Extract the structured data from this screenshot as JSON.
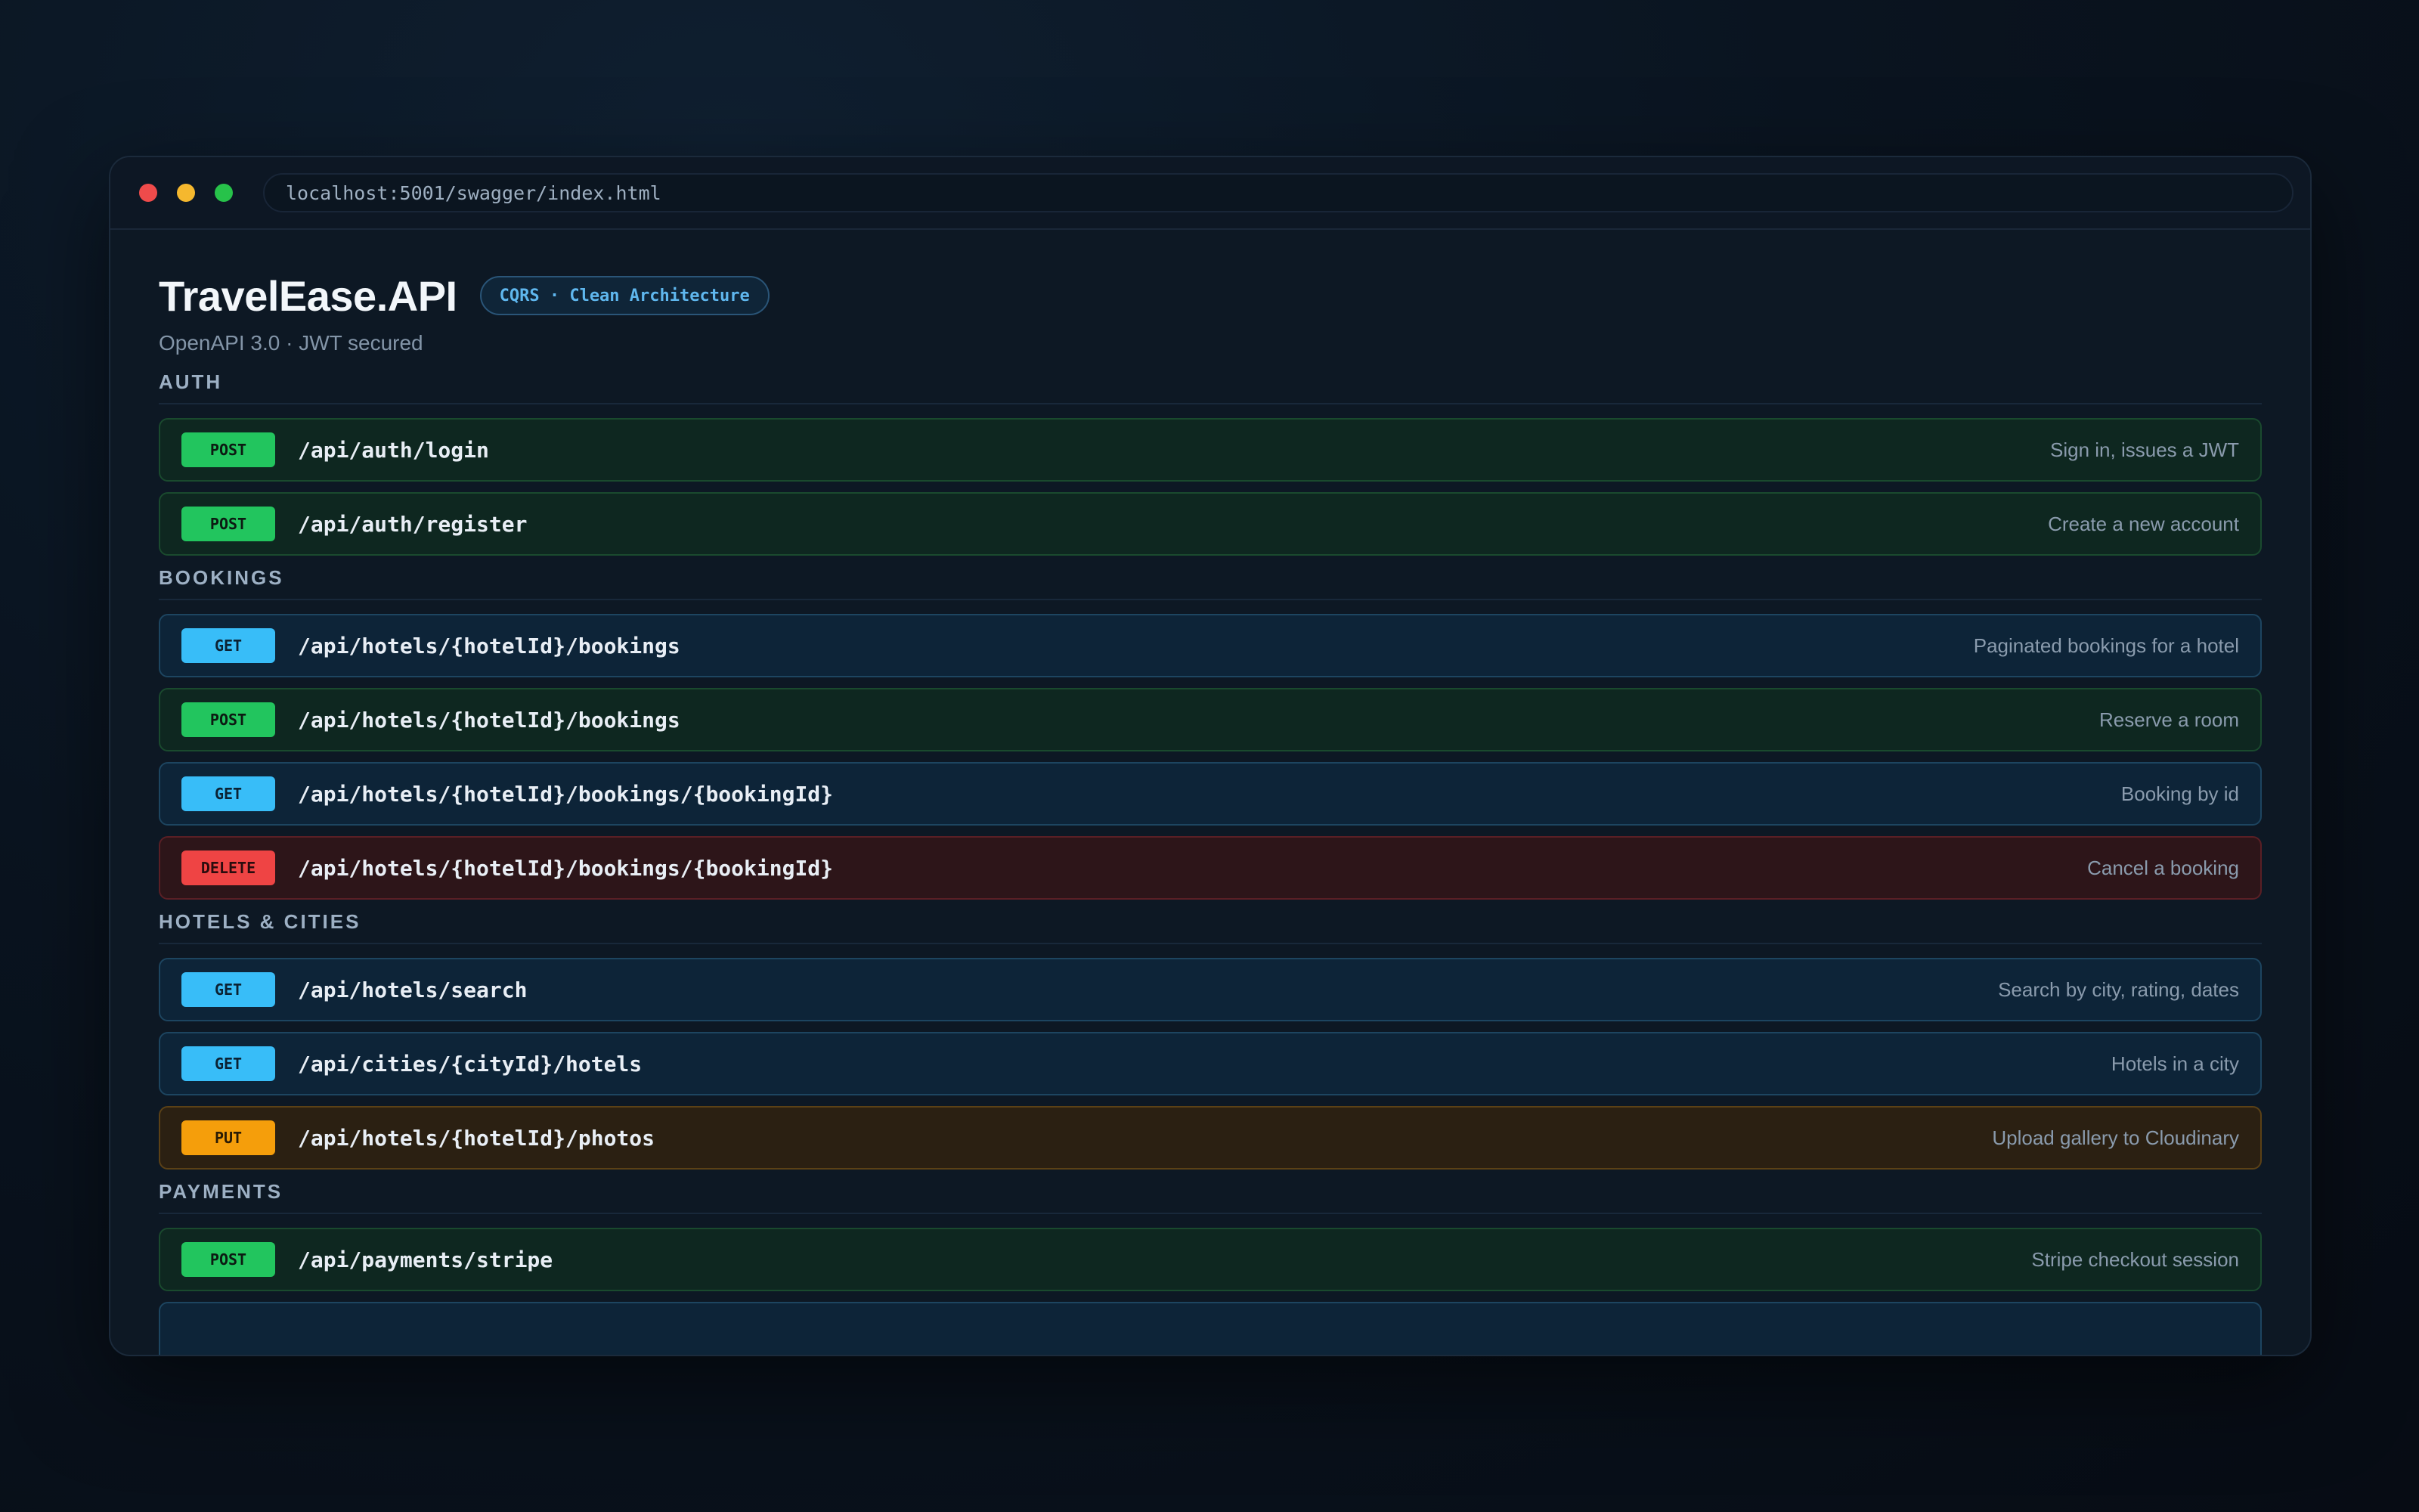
{
  "browser": {
    "url": "localhost:5001/swagger/index.html"
  },
  "header": {
    "title": "TravelEase.API",
    "badge": "CQRS · Clean Architecture",
    "subtitle": "OpenAPI 3.0 · JWT secured"
  },
  "sections": [
    {
      "title": "AUTH",
      "endpoints": [
        {
          "method": "POST",
          "path": "/api/auth/login",
          "description": "Sign in, issues a JWT"
        },
        {
          "method": "POST",
          "path": "/api/auth/register",
          "description": "Create a new account"
        }
      ]
    },
    {
      "title": "BOOKINGS",
      "endpoints": [
        {
          "method": "GET",
          "path": "/api/hotels/{hotelId}/bookings",
          "description": "Paginated bookings for a hotel"
        },
        {
          "method": "POST",
          "path": "/api/hotels/{hotelId}/bookings",
          "description": "Reserve a room"
        },
        {
          "method": "GET",
          "path": "/api/hotels/{hotelId}/bookings/{bookingId}",
          "description": "Booking by id"
        },
        {
          "method": "DELETE",
          "path": "/api/hotels/{hotelId}/bookings/{bookingId}",
          "description": "Cancel a booking"
        }
      ]
    },
    {
      "title": "HOTELS & CITIES",
      "endpoints": [
        {
          "method": "GET",
          "path": "/api/hotels/search",
          "description": "Search by city, rating, dates"
        },
        {
          "method": "GET",
          "path": "/api/cities/{cityId}/hotels",
          "description": "Hotels in a city"
        },
        {
          "method": "PUT",
          "path": "/api/hotels/{hotelId}/photos",
          "description": "Upload gallery to Cloudinary"
        }
      ]
    },
    {
      "title": "PAYMENTS",
      "endpoints": [
        {
          "method": "POST",
          "path": "/api/payments/stripe",
          "description": "Stripe checkout session"
        }
      ]
    }
  ],
  "colors": {
    "post": "#22c55e",
    "get": "#38bdf8",
    "delete": "#ef4444",
    "put": "#f59e0b"
  }
}
